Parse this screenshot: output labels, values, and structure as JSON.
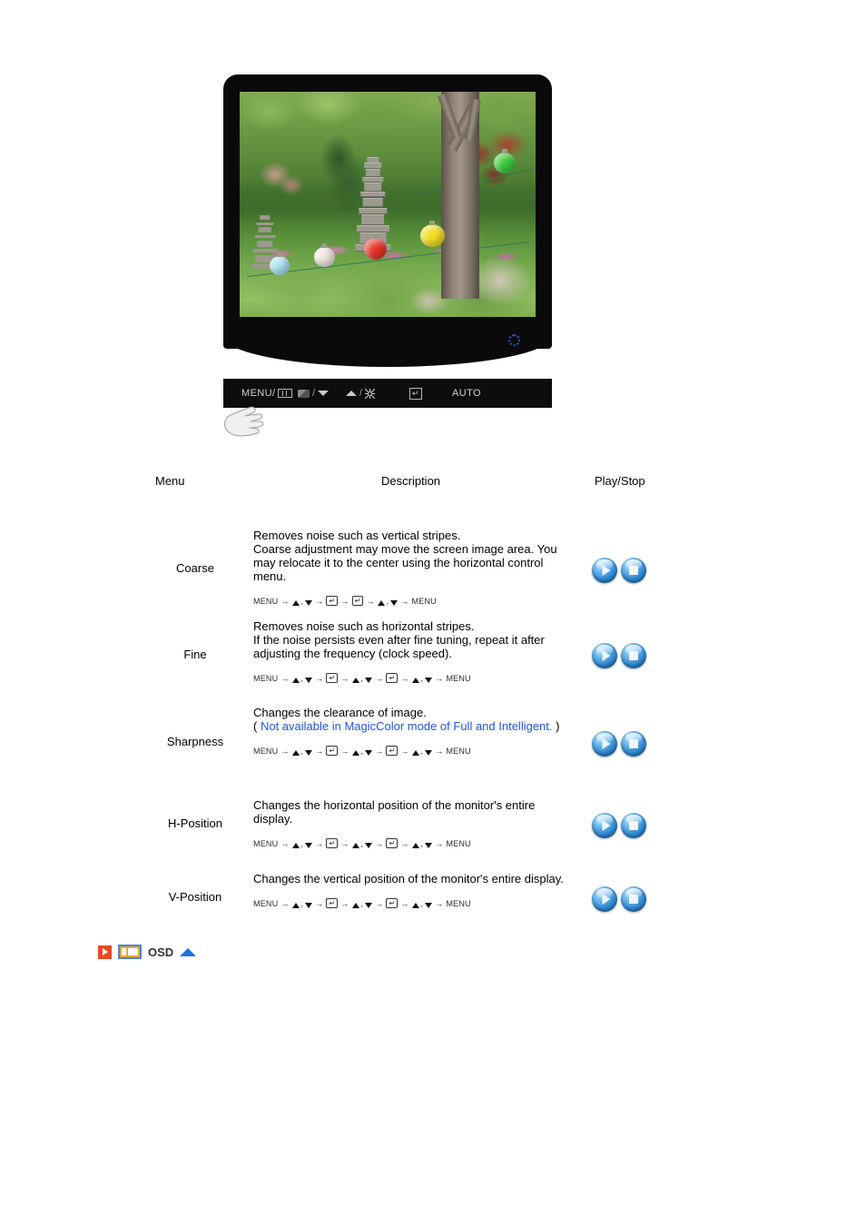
{
  "monitor": {
    "power_led": "power-led-indicator",
    "screen_image_alt": "garden-photo-with-pagoda-and-lanterns",
    "control_bar": {
      "buttons": [
        {
          "label": "MENU/",
          "icon": "osd-window-icon"
        },
        {
          "label": "",
          "icon": "magicbright-icon",
          "separator": "/",
          "icon2": "down-arrow-icon"
        },
        {
          "label": "",
          "icon": "up-arrow-icon",
          "separator": "/",
          "icon2": "brightness-sun-icon"
        },
        {
          "label": "",
          "icon": "enter-icon"
        },
        {
          "label": "AUTO",
          "icon": ""
        }
      ]
    }
  },
  "table": {
    "headers": {
      "menu": "Menu",
      "description": "Description",
      "play_stop": "Play/Stop"
    },
    "rows": [
      {
        "menu": "Coarse",
        "description_lines": [
          "Removes noise such as vertical stripes.",
          "Coarse adjustment may move the screen image area. You may relocate it to the center using the horizontal control menu."
        ],
        "note": "",
        "nav_sequence": [
          "MENU",
          "ARROWS",
          "ENTER",
          "ENTER",
          "ARROWS",
          "MENU"
        ],
        "nav_text": "MENU → ▲ , ▼ → ↵ → ↵ → ▲ , ▼ → MENU",
        "play_label": "play-button",
        "stop_label": "stop-button"
      },
      {
        "menu": "Fine",
        "description_lines": [
          "Removes noise such as horizontal stripes.",
          "If the noise persists even after fine tuning, repeat it after adjusting the frequency (clock speed)."
        ],
        "note": "",
        "nav_sequence": [
          "MENU",
          "ARROWS",
          "ENTER",
          "ARROWS",
          "ENTER",
          "ARROWS",
          "MENU"
        ],
        "nav_text": "MENU → ▲ , ▼ → ↵ → ▲ , ▼ → ↵ → ▲ , ▼ → MENU",
        "play_label": "play-button",
        "stop_label": "stop-button"
      },
      {
        "menu": "Sharpness",
        "description_lines": [
          "Changes the clearance of image."
        ],
        "note_prefix": "( ",
        "note": "Not available in MagicColor mode of Full and Intelligent.",
        "note_suffix": " )",
        "nav_sequence": [
          "MENU",
          "ARROWS",
          "ENTER",
          "ARROWS",
          "ENTER",
          "ARROWS",
          "MENU"
        ],
        "nav_text": "MENU → ▲ , ▼ → ↵ → ▲ , ▼ → ↵ → ▲ , ▼ → MENU",
        "play_label": "play-button",
        "stop_label": "stop-button"
      },
      {
        "menu": "H-Position",
        "description_lines": [
          "Changes the horizontal position of the monitor's entire display."
        ],
        "note": "",
        "nav_sequence": [
          "MENU",
          "ARROWS",
          "ENTER",
          "ARROWS",
          "ENTER",
          "ARROWS",
          "MENU"
        ],
        "nav_text": "MENU → ▲ , ▼ → ↵ → ▲ , ▼ → ↵ → ▲ , ▼ → MENU",
        "play_label": "play-button",
        "stop_label": "stop-button"
      },
      {
        "menu": "V-Position",
        "description_lines": [
          "Changes the vertical position of the monitor's entire display."
        ],
        "note": "",
        "nav_sequence": [
          "MENU",
          "ARROWS",
          "ENTER",
          "ARROWS",
          "ENTER",
          "ARROWS",
          "MENU"
        ],
        "nav_text": "MENU → ▲ , ▼ → ↵ → ▲ , ▼ → ↵ → ▲ , ▼ → MENU",
        "play_label": "play-button",
        "stop_label": "stop-button"
      }
    ]
  },
  "footer": {
    "osd_label": "OSD",
    "play_icon": "play-icon",
    "osd_icon": "osd-screen-icon",
    "top_icon": "scroll-to-top-icon"
  },
  "colors": {
    "note_blue": "#2255dd",
    "accent_orange": "#e8491d",
    "osd_icon_fill": "#e8a33d",
    "osd_icon_border": "#4f86c6",
    "top_triangle": "#1c6fe0",
    "button_blue": "#2f86cf"
  }
}
